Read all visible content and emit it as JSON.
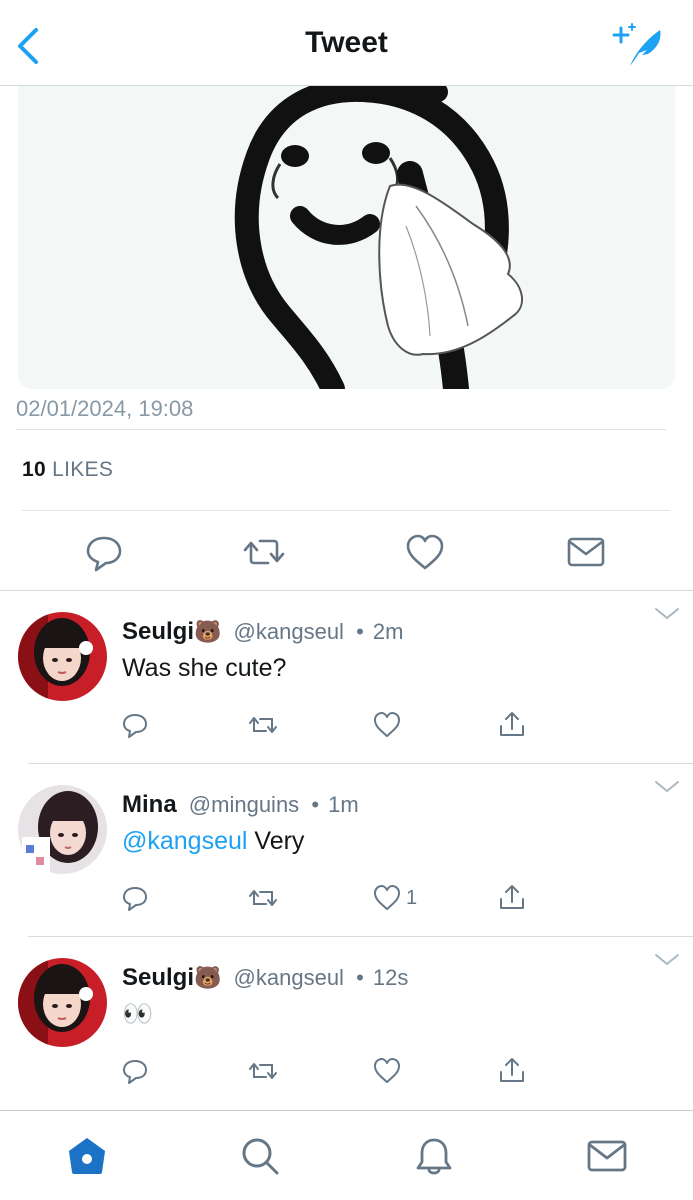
{
  "header": {
    "title": "Tweet",
    "accent_color": "#1da1f2"
  },
  "tweet": {
    "timestamp": "02/01/2024, 19:08",
    "likes_count": "10",
    "likes_label": "LIKES",
    "actions": [
      "reply-icon",
      "retweet-icon",
      "heart-icon",
      "mail-icon"
    ]
  },
  "replies": [
    {
      "name": "Seulgi",
      "name_emoji": "🐻",
      "handle": "@kangseul",
      "separator": "•",
      "time": "2m",
      "mention": "",
      "text": "Was she cute?",
      "like_count": ""
    },
    {
      "name": "Mina",
      "name_emoji": "",
      "handle": "@minguins",
      "separator": "•",
      "time": "1m",
      "mention": "@kangseul",
      "text": " Very",
      "like_count": "1"
    },
    {
      "name": "Seulgi",
      "name_emoji": "🐻",
      "handle": "@kangseul",
      "separator": "•",
      "time": "12s",
      "mention": "",
      "text": "👀",
      "like_count": ""
    }
  ],
  "tabbar": {
    "items": [
      "home-icon",
      "search-icon",
      "bell-icon",
      "messages-icon"
    ],
    "active": "home-icon"
  }
}
